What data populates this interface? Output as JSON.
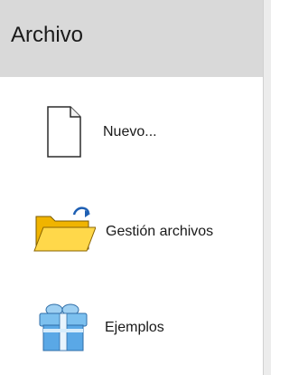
{
  "header": {
    "title": "Archivo"
  },
  "menu": {
    "items": [
      {
        "label": "Nuevo...",
        "icon": "new-document-icon"
      },
      {
        "label": "Gestión archivos",
        "icon": "folder-sync-icon"
      },
      {
        "label": "Ejemplos",
        "icon": "gift-box-icon"
      }
    ]
  },
  "colors": {
    "header_bg": "#d9d9d9",
    "folder_yellow": "#f4c20d",
    "arrow_blue": "#1e5fb3",
    "gift_blue": "#5aa8e6"
  }
}
